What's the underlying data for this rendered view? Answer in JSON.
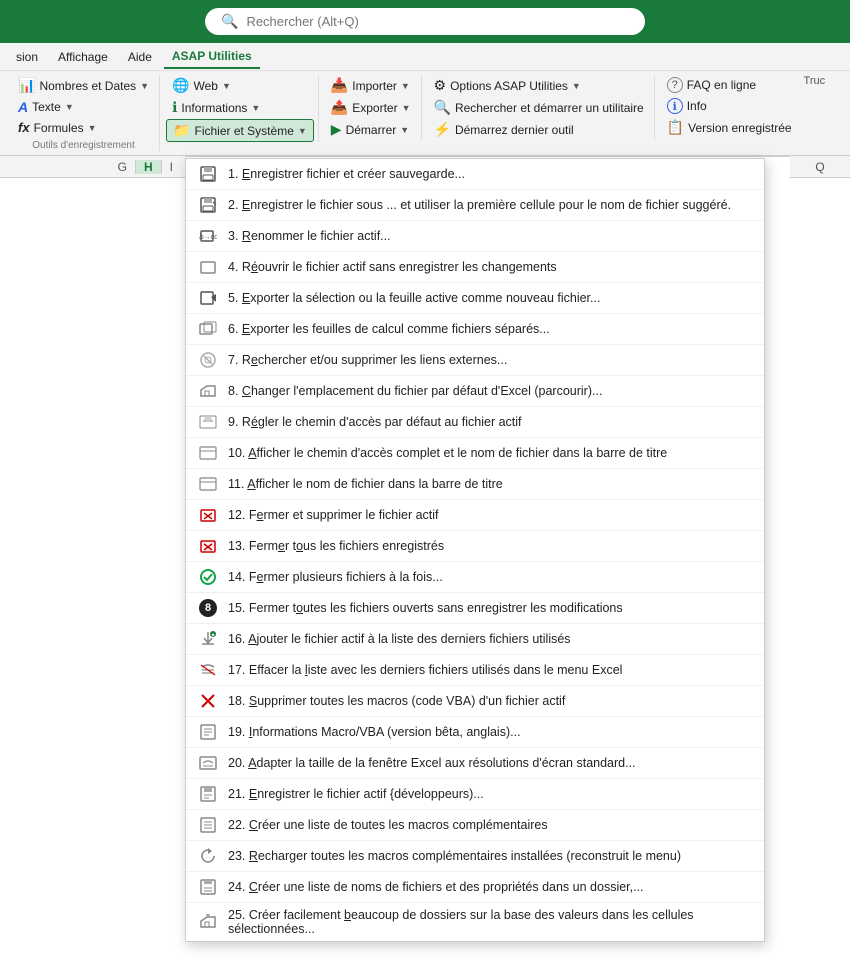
{
  "searchbar": {
    "placeholder": "Rechercher (Alt+Q)"
  },
  "menubar": {
    "items": [
      "sion",
      "Affichage",
      "Aide",
      "ASAP Utilities"
    ]
  },
  "ribbon": {
    "groups": [
      {
        "label": "Outils d'enregistrement",
        "buttons": [
          {
            "label": "Nombres et Dates",
            "icon": "📊",
            "dropdown": true
          },
          {
            "label": "Texte",
            "icon": "A",
            "dropdown": true
          },
          {
            "label": "Formules",
            "icon": "fx",
            "dropdown": true
          }
        ]
      },
      {
        "col1": [
          {
            "label": "Web",
            "icon": "🌐",
            "dropdown": true
          },
          {
            "label": "Informations",
            "icon": "ℹ",
            "dropdown": true
          },
          {
            "label": "Fichier et Système",
            "icon": "📁",
            "dropdown": true,
            "active": true
          }
        ],
        "col2": [
          {
            "label": "Importer",
            "icon": "📥",
            "dropdown": true
          },
          {
            "label": "Exporter",
            "icon": "📤",
            "dropdown": true
          },
          {
            "label": "Démarrer",
            "icon": "▶",
            "dropdown": true
          }
        ],
        "col3": [
          {
            "label": "Options ASAP Utilities",
            "icon": "⚙",
            "dropdown": true
          },
          {
            "label": "Rechercher et démarrer un utilitaire",
            "icon": "🔍"
          },
          {
            "label": "Démarrez dernier outil",
            "icon": "⚡"
          }
        ],
        "col4": [
          {
            "label": "FAQ en ligne",
            "icon": "?"
          },
          {
            "label": "Info",
            "icon": "ℹ"
          },
          {
            "label": "Version enregistrée",
            "icon": "📋"
          }
        ]
      }
    ],
    "trucs_label": "Truc"
  },
  "dropdown": {
    "items": [
      {
        "num": "1.",
        "text": "Enregistrer fichier et créer sauvegarde...",
        "icon": "save",
        "underline": "E"
      },
      {
        "num": "2.",
        "text": "Enregistrer le fichier sous ... et utiliser la première cellule pour le nom de fichier suggéré.",
        "icon": "saveas",
        "underline": "E"
      },
      {
        "num": "3.",
        "text": "Renommer le fichier actif...",
        "icon": "rename",
        "underline": "R"
      },
      {
        "num": "4.",
        "text": "Réouvrir le fichier actif sans enregistrer les changements",
        "icon": "reopen",
        "underline": "é"
      },
      {
        "num": "5.",
        "text": "Exporter la sélection ou la feuille active comme nouveau fichier...",
        "icon": "export",
        "underline": "E"
      },
      {
        "num": "6.",
        "text": "Exporter les feuilles de calcul comme fichiers séparés...",
        "icon": "exportsheets",
        "underline": "E"
      },
      {
        "num": "7.",
        "text": "Rechercher et/ou supprimer les liens externes...",
        "icon": "links",
        "underline": "e"
      },
      {
        "num": "8.",
        "text": "Changer l'emplacement du fichier par défaut d'Excel (parcourir)...",
        "icon": "folder",
        "underline": "C"
      },
      {
        "num": "9.",
        "text": "Régler le chemin d'accès par défaut au fichier actif",
        "icon": "path",
        "underline": "é"
      },
      {
        "num": "10.",
        "text": "Afficher le chemin d'accès complet et le nom de fichier dans la barre de titre",
        "icon": "titlebar",
        "underline": "A"
      },
      {
        "num": "11.",
        "text": "Afficher le nom de fichier dans la barre de titre",
        "icon": "titlebar2",
        "underline": "A"
      },
      {
        "num": "12.",
        "text": "Fermer et supprimer le fichier actif",
        "icon": "closedelete",
        "underline": "e"
      },
      {
        "num": "13.",
        "text": "Fermer tous les fichiers enregistrés",
        "icon": "closeall",
        "underline": "o"
      },
      {
        "num": "14.",
        "text": "Fermer plusieurs fichiers à la fois...",
        "icon": "closemulti",
        "underline": "e"
      },
      {
        "num": "15.",
        "text": "Fermer toutes les fichiers ouverts sans enregistrer les modifications",
        "icon": "closenosave",
        "underline": "o"
      },
      {
        "num": "16.",
        "text": "Ajouter le fichier actif  à la liste des derniers fichiers utilisés",
        "icon": "recent",
        "underline": "A"
      },
      {
        "num": "17.",
        "text": "Effacer la liste avec les derniers fichiers utilisés dans le menu Excel",
        "icon": "clearrecent",
        "underline": "l"
      },
      {
        "num": "18.",
        "text": "Supprimer toutes les macros (code VBA) d'un fichier actif",
        "icon": "deletemacro",
        "underline": "S"
      },
      {
        "num": "19.",
        "text": "Informations Macro/VBA (version bêta, anglais)...",
        "icon": "macroinfo",
        "underline": "I"
      },
      {
        "num": "20.",
        "text": "Adapter la taille de la fenêtre Excel aux résolutions d'écran standard...",
        "icon": "resize",
        "underline": "A"
      },
      {
        "num": "21.",
        "text": "Enregistrer le fichier actif  {développeurs)...",
        "icon": "savedev",
        "underline": "E"
      },
      {
        "num": "22.",
        "text": "Créer une liste de toutes les macros complémentaires",
        "icon": "listmacros",
        "underline": "C"
      },
      {
        "num": "23.",
        "text": "Recharger toutes les macros complémentaires installées (reconstruit le menu)",
        "icon": "reload",
        "underline": "R"
      },
      {
        "num": "24.",
        "text": "Créer une liste de noms de fichiers et des propriétés dans un dossier,...",
        "icon": "filelist",
        "underline": "C"
      },
      {
        "num": "25.",
        "text": "Créer facilement beaucoup de dossiers sur la base des valeurs dans les cellules sélectionnées...",
        "icon": "createfolders",
        "underline": "b"
      }
    ]
  },
  "spreadsheet": {
    "columns": [
      "G",
      "H",
      "I",
      "Q"
    ],
    "selected_col": "H"
  }
}
